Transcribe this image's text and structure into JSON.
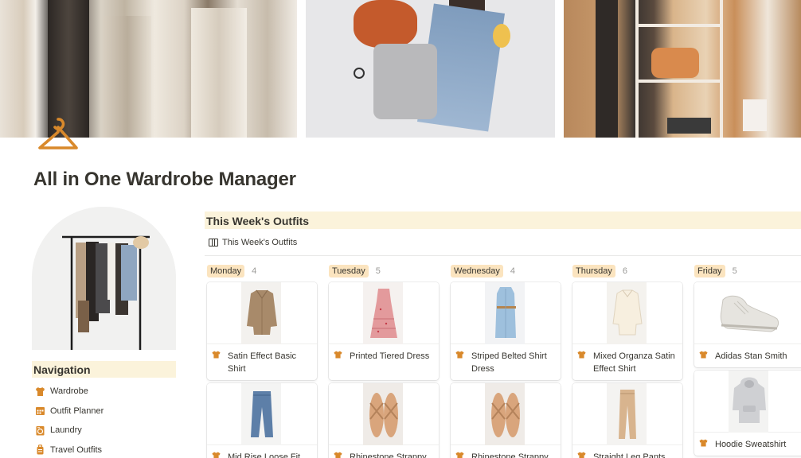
{
  "page": {
    "title": "All in One Wardrobe Manager"
  },
  "navigation": {
    "heading": "Navigation",
    "items": [
      {
        "label": "Wardrobe",
        "icon": "shirt-icon"
      },
      {
        "label": "Outfit Planner",
        "icon": "calendar-icon"
      },
      {
        "label": "Laundry",
        "icon": "washing-machine-icon"
      },
      {
        "label": "Travel Outfits",
        "icon": "suitcase-icon"
      }
    ]
  },
  "board": {
    "title": "This Week's Outfits",
    "view_tab": "This Week's Outfits",
    "columns": [
      {
        "day": "Monday",
        "count": "4",
        "cards": [
          {
            "name": "Satin Effect Basic Shirt",
            "image": "shirt-jacket"
          },
          {
            "name": "Mid Rise Loose Fit",
            "image": "jeans"
          }
        ]
      },
      {
        "day": "Tuesday",
        "count": "5",
        "cards": [
          {
            "name": "Printed Tiered Dress",
            "image": "floral-dress"
          },
          {
            "name": "Rhinestone Strappy",
            "image": "sandals"
          }
        ]
      },
      {
        "day": "Wednesday",
        "count": "4",
        "cards": [
          {
            "name": "Striped Belted Shirt Dress",
            "image": "shirt-dress"
          },
          {
            "name": "Rhinestone Strappy",
            "image": "sandals"
          }
        ]
      },
      {
        "day": "Thursday",
        "count": "6",
        "cards": [
          {
            "name": "Mixed Organza Satin Effect Shirt",
            "image": "white-shirt"
          },
          {
            "name": "Straight Leg Pants",
            "image": "beige-pants"
          }
        ]
      },
      {
        "day": "Friday",
        "count": "5",
        "cards": [
          {
            "name": "Adidas Stan Smith",
            "image": "sneaker"
          },
          {
            "name": "Hoodie Sweatshirt",
            "image": "hoodie"
          }
        ]
      }
    ]
  },
  "colors": {
    "accent": "#d9892b",
    "highlight": "#fbf3db",
    "tag": "#fbe4bf",
    "text": "#37352f",
    "muted": "#9b9a97"
  }
}
